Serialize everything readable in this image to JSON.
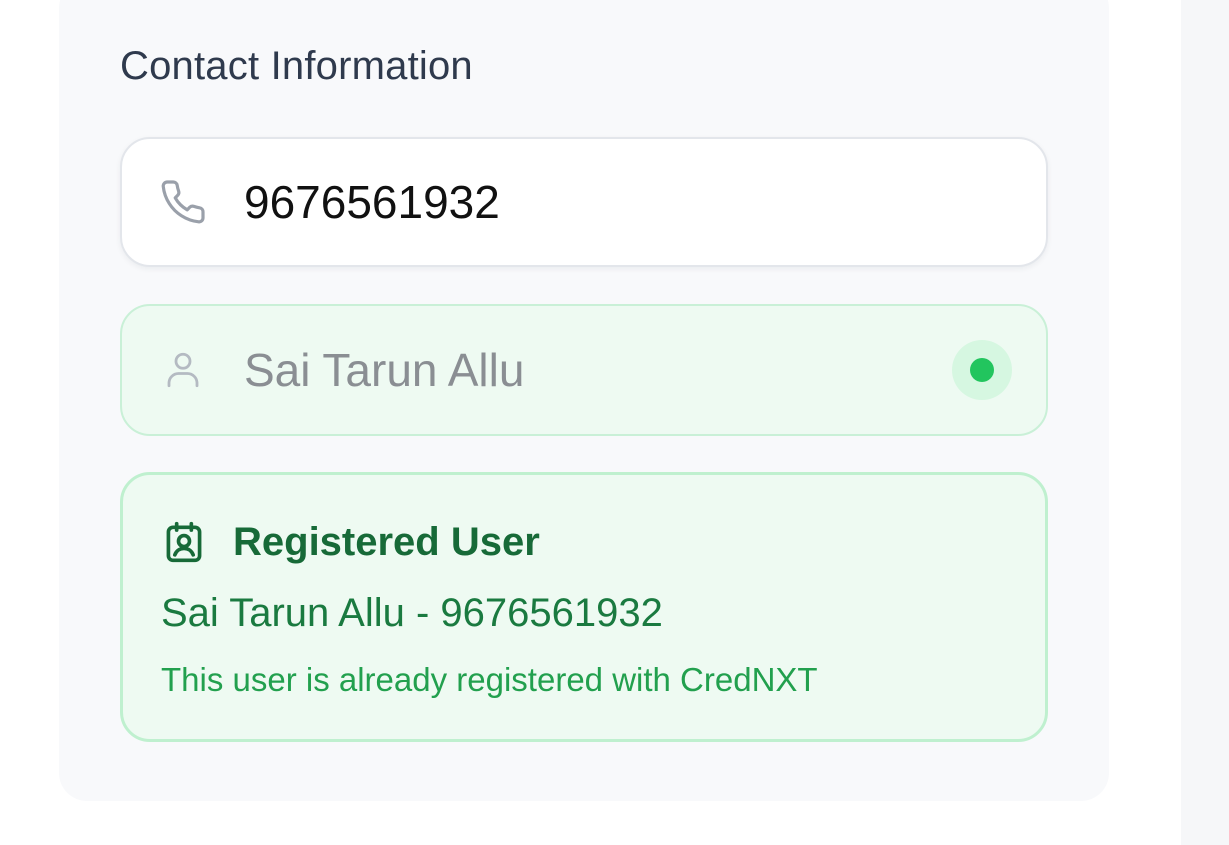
{
  "contact_section": {
    "title": "Contact Information"
  },
  "phone_field": {
    "value": "9676561932",
    "icon": "phone-icon"
  },
  "name_field": {
    "value": "Sai Tarun Allu",
    "icon": "user-icon",
    "status": "verified",
    "status_color": "#22c55e"
  },
  "registered_user": {
    "icon": "id-badge-icon",
    "title": "Registered User",
    "detail": "Sai Tarun Allu - 9676561932",
    "note": "This user is already registered with CredNXT"
  },
  "colors": {
    "accent_green": "#22c55e",
    "title_text": "#2f3a4d",
    "success_bg": "#eefaf2"
  }
}
